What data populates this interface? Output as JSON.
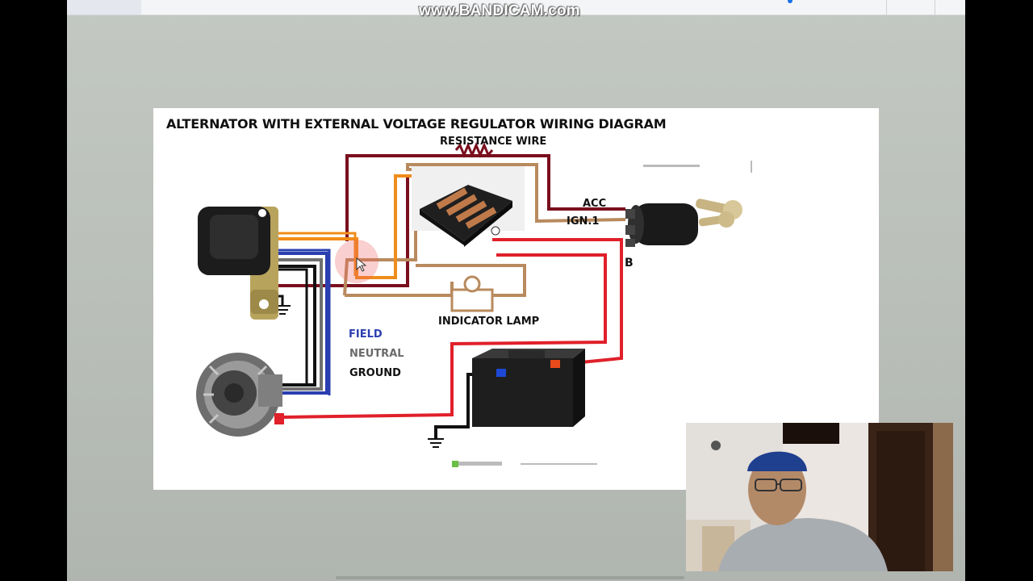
{
  "recording": {
    "watermark": "www.BANDICAM.com"
  },
  "slide": {
    "title": "ALTERNATOR WITH EXTERNAL VOLTAGE REGULATOR WIRING DIAGRAM",
    "labels": {
      "resistance_wire": "RESISTANCE WIRE",
      "acc": "ACC",
      "ign1": "IGN.1",
      "b": "B",
      "indicator_lamp": "INDICATOR LAMP",
      "field": "FIELD",
      "neutral": "NEUTRAL",
      "ground": "GROUND"
    },
    "wire_colors": {
      "field": "#2b3fb0",
      "neutral": "#707070",
      "ground": "#111111",
      "battery": "#e0202a",
      "ignition": "#7a0f1e",
      "lamp": "#b88a5e",
      "orange": "#f08c1a"
    }
  },
  "components": [
    "voltage-regulator",
    "alternator",
    "fuse-box",
    "ignition-switch",
    "indicator-lamp",
    "battery",
    "chassis-ground"
  ]
}
